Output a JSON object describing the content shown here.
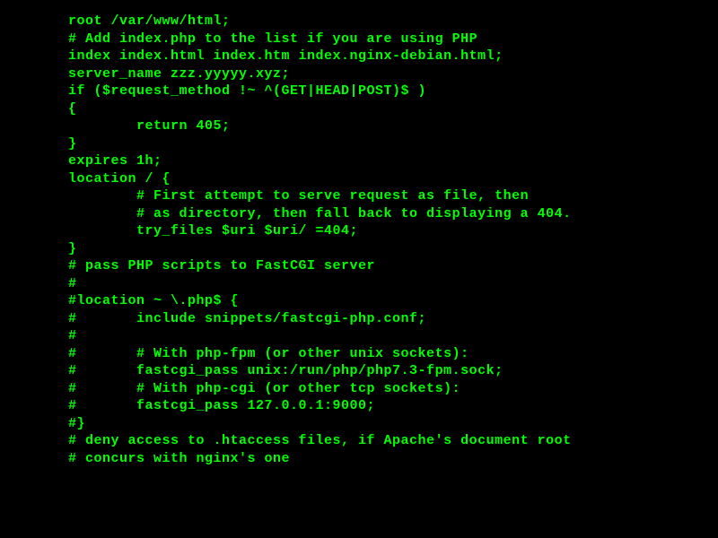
{
  "terminal": {
    "lines": [
      "root /var/www/html;",
      "",
      "# Add index.php to the list if you are using PHP",
      "index index.html index.htm index.nginx-debian.html;",
      "",
      "server_name zzz.yyyyy.xyz;",
      "if ($request_method !~ ^(GET|HEAD|POST)$ )",
      "{",
      "        return 405;",
      "}",
      "expires 1h;",
      "",
      "location / {",
      "        # First attempt to serve request as file, then",
      "        # as directory, then fall back to displaying a 404.",
      "        try_files $uri $uri/ =404;",
      "}",
      "",
      "# pass PHP scripts to FastCGI server",
      "#",
      "#location ~ \\.php$ {",
      "#       include snippets/fastcgi-php.conf;",
      "#",
      "#       # With php-fpm (or other unix sockets):",
      "#       fastcgi_pass unix:/run/php/php7.3-fpm.sock;",
      "#       # With php-cgi (or other tcp sockets):",
      "#       fastcgi_pass 127.0.0.1:9000;",
      "#}",
      "",
      "# deny access to .htaccess files, if Apache's document root",
      "# concurs with nginx's one"
    ]
  }
}
